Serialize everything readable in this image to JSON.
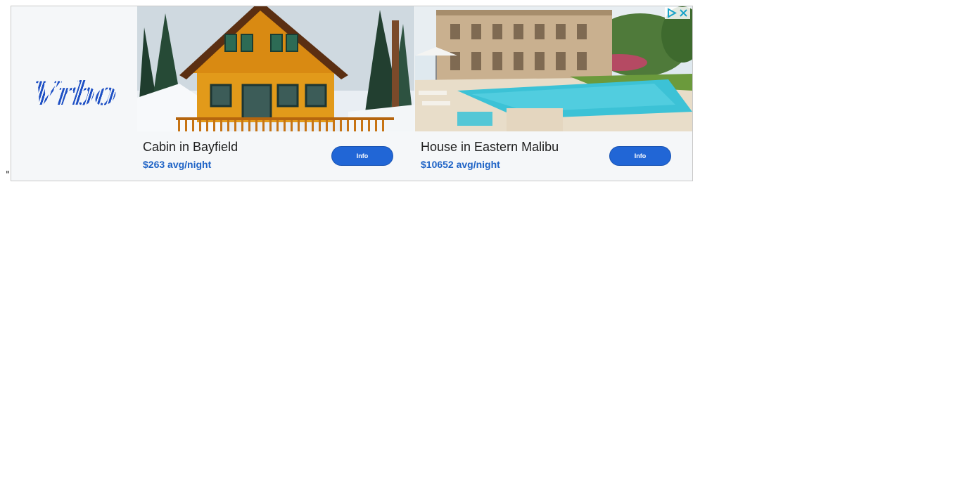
{
  "page": {
    "stray_text": "\""
  },
  "ad": {
    "brand": {
      "logo_text": "Vrbo",
      "color": "#1d4fc4"
    },
    "listings": [
      {
        "title": "Cabin in Bayfield",
        "price": "$263 avg/night",
        "button_label": "Info",
        "image": "orange-cabin-in-snowy-forest"
      },
      {
        "title": "House in Eastern Malibu",
        "price": "$10652 avg/night",
        "button_label": "Info",
        "image": "villa-with-pool"
      }
    ],
    "controls": {
      "adchoices_icon": "play-triangle-icon",
      "close_icon": "close-icon"
    },
    "colors": {
      "button": "#2166d6",
      "price": "#1e63c6",
      "background": "#f5f7f9"
    }
  }
}
